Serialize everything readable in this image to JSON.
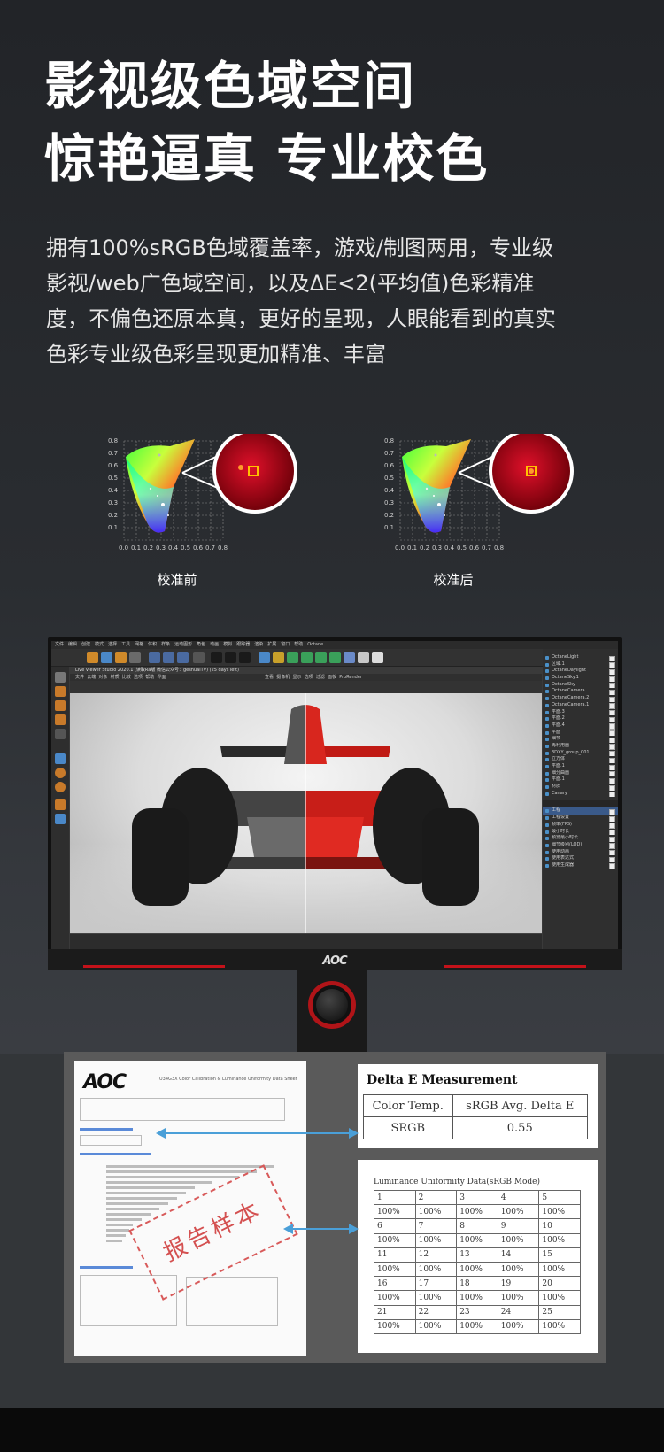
{
  "headline": {
    "line1": "影视级色域空间",
    "line2": "惊艳逼真 专业校色"
  },
  "description": {
    "lines": [
      "拥有100%sRGB色域覆盖率，游戏/制图两用，专业级",
      "影视/web广色域空间，以及ΔE<2(平均值)色彩精准",
      "度，不偏色还原本真，更好的呈现，人眼能看到的真实",
      "色彩专业级色彩呈现更加精准、丰富"
    ]
  },
  "cie_charts": {
    "before_caption": "校准前",
    "after_caption": "校准后",
    "y_ticks": [
      "0.8",
      "0.7",
      "0.6",
      "0.5",
      "0.4",
      "0.3",
      "0.2",
      "0.1"
    ],
    "x_ticks": [
      "0.0",
      "0.1",
      "0.2",
      "0.3",
      "0.4",
      "0.5",
      "0.6",
      "0.7",
      "0.8"
    ]
  },
  "monitor": {
    "brand_logo": "AOC",
    "app_title": "Octane",
    "menu_items": [
      "文件",
      "编辑",
      "创建",
      "模式",
      "选择",
      "工具",
      "网格",
      "体积",
      "样条",
      "运动图形",
      "角色",
      "动画",
      "模拟",
      "跟踪器",
      "渲染",
      "扩展",
      "窗口",
      "帮助",
      "Octane"
    ],
    "viewer_title": "Live Viewer Studio 2020.1 (读取Ra版 微信公众号：geshuaiTV) (25 days left)",
    "viewer_menu": [
      "文件",
      "云端",
      "对象",
      "材质",
      "比较",
      "选项",
      "帮助",
      "界面"
    ],
    "viewport_tabs": [
      "查看",
      "摄像机",
      "显示",
      "选项",
      "过滤",
      "面板",
      "ProRender"
    ],
    "scene_objects": [
      "OctaneLight",
      "区域.1",
      "OctaneDaylight",
      "OctaneSky.1",
      "OctaneSky",
      "OctaneCamera",
      "OctaneCamera.2",
      "OctaneCamera.1",
      "平面.3",
      "平面.2",
      "平面.4",
      "平面",
      "细节",
      "再利用面",
      "3DXY_group_001",
      "立方体",
      "平面.1",
      "细分曲面",
      "平面.1",
      "材质",
      "Canary"
    ],
    "attribute_labels": [
      "工程",
      "工程设置",
      "帧率(FPS)",
      "最小时长",
      "预览最小时长",
      "细节级别(LOD)",
      "使用动画",
      "使用表达式",
      "使用生成器"
    ]
  },
  "report": {
    "doc_logo": "AOC",
    "doc_title": "U34G3X   Color Calibration & Luminance Uniformity Data Sheet",
    "stamp_text": "报告样本",
    "delta_e": {
      "title": "Delta E Measurement",
      "headers": [
        "Color Temp.",
        "sRGB Avg. Delta E"
      ],
      "row": [
        "SRGB",
        "0.55"
      ]
    },
    "luminance": {
      "title": "Luminance Uniformity Data(sRGB Mode)",
      "rows": [
        [
          "1",
          "2",
          "3",
          "4",
          "5"
        ],
        [
          "100%",
          "100%",
          "100%",
          "100%",
          "100%"
        ],
        [
          "6",
          "7",
          "8",
          "9",
          "10"
        ],
        [
          "100%",
          "100%",
          "100%",
          "100%",
          "100%"
        ],
        [
          "11",
          "12",
          "13",
          "14",
          "15"
        ],
        [
          "100%",
          "100%",
          "100%",
          "100%",
          "100%"
        ],
        [
          "16",
          "17",
          "18",
          "19",
          "20"
        ],
        [
          "100%",
          "100%",
          "100%",
          "100%",
          "100%"
        ],
        [
          "21",
          "22",
          "23",
          "24",
          "25"
        ],
        [
          "100%",
          "100%",
          "100%",
          "100%",
          "100%"
        ]
      ]
    }
  },
  "colors": {
    "accent_red": "#c4121a",
    "arrow_blue": "#4a9fd8"
  }
}
